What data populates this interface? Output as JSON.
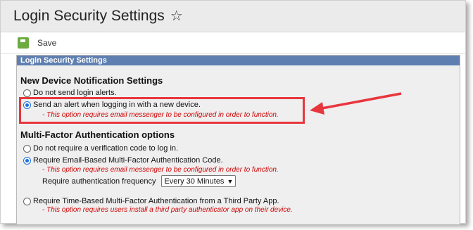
{
  "header": {
    "title": "Login Security Settings",
    "star_icon": "star-icon"
  },
  "toolbar": {
    "save_label": "Save",
    "save_icon": "save-icon"
  },
  "panel": {
    "header": "Login Security Settings",
    "device_section": {
      "heading": "New Device Notification Settings",
      "options": [
        {
          "label": "Do not send login alerts.",
          "checked": false
        },
        {
          "label": "Send an alert when logging in with a new device.",
          "checked": true
        }
      ],
      "note": "- This option requires email messenger to be configured in order to function."
    },
    "mfa_section": {
      "heading": "Multi-Factor Authentication options",
      "options": [
        {
          "label": "Do not require a verification code to log in.",
          "checked": false
        },
        {
          "label": "Require Email-Based Multi-Factor Authentication Code.",
          "checked": true
        },
        {
          "label": "Require Time-Based Multi-Factor Authentication from a Third Party App.",
          "checked": false
        }
      ],
      "email_note": "- This option requires email messenger to be configured in order to function.",
      "frequency_label": "Require authentication frequency",
      "frequency_value": "Every 30 Minutes",
      "app_note": "- This option requires users install a third party authenticator app on their device."
    }
  },
  "colors": {
    "highlight": "#e8363d",
    "note": "#d00000",
    "panel_header": "#5e7fb0"
  }
}
